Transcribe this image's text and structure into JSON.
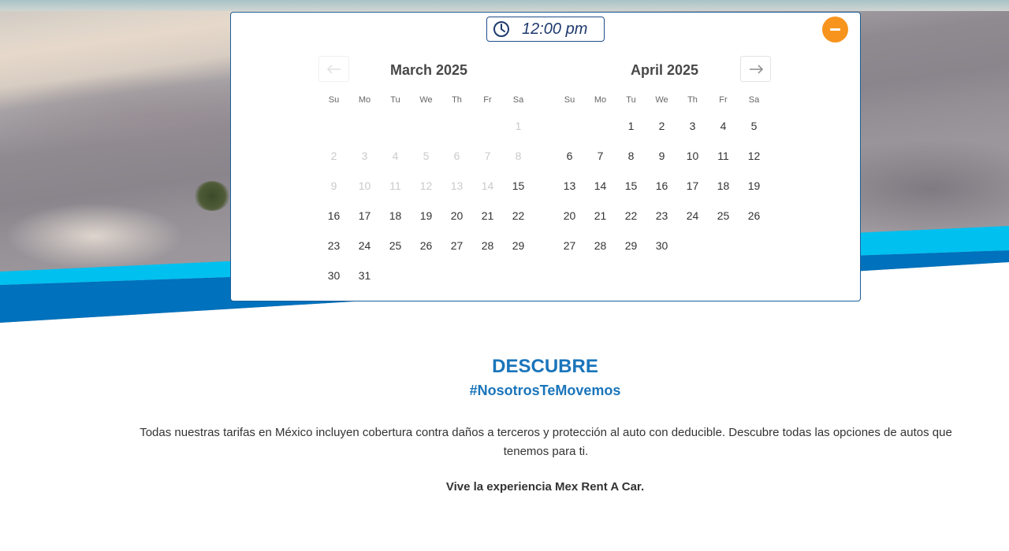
{
  "time_picker": {
    "value": "12:00 pm"
  },
  "calendars": [
    {
      "title": "March 2025",
      "weekdays": [
        "Su",
        "Mo",
        "Tu",
        "We",
        "Th",
        "Fr",
        "Sa"
      ],
      "first_weekday_index": 6,
      "days_in_month": 31,
      "first_enabled_day": 15
    },
    {
      "title": "April 2025",
      "weekdays": [
        "Su",
        "Mo",
        "Tu",
        "We",
        "Th",
        "Fr",
        "Sa"
      ],
      "first_weekday_index": 2,
      "days_in_month": 30,
      "first_enabled_day": 1
    }
  ],
  "section": {
    "title": "DESCUBRE",
    "hashtag": "#NosotrosTeMovemos",
    "body": "Todas nuestras tarifas en México incluyen cobertura contra daños a terceros y protección al auto con deducible. Descubre todas las opciones de autos que tenemos para ti.",
    "tagline": "Vive la experiencia Mex Rent A Car."
  },
  "colors": {
    "brand_blue": "#1a75bb",
    "stripe_light": "#00c0f0",
    "stripe_dark": "#0071bc",
    "close_button": "#f7941d",
    "card_border": "#1a5f99"
  },
  "icons": {
    "time": "clock-icon",
    "close": "minus-icon",
    "prev": "arrow-left-icon",
    "next": "arrow-right-icon"
  }
}
